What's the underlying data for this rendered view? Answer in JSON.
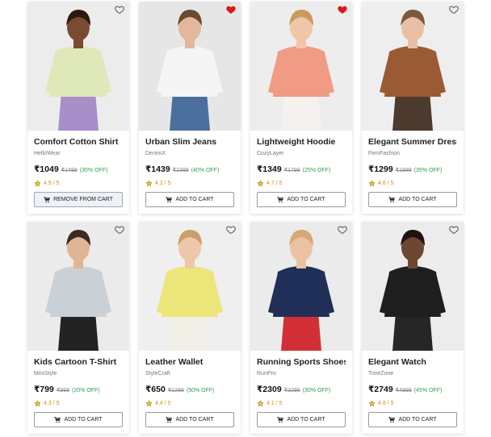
{
  "colors": {
    "heart_active": "#e0141e",
    "heart_inactive": "#555555",
    "rating": "#d28b14",
    "discount": "#2e9a4f"
  },
  "products": [
    {
      "title": "Comfort Cotton Shirt",
      "brand": "HelloWear",
      "price": "₹1049",
      "mrp": "₹1499",
      "discount": "(30% OFF)",
      "rating": "4.5 / 5",
      "button": "REMOVE FROM CART",
      "wishlisted": false,
      "in_cart": true,
      "photo_icon": "model-photo",
      "palette": {
        "skin": "#7a4b33",
        "hair": "#2a1a12",
        "top": "#dfe8b8",
        "bottom": "#a98fc9",
        "bg": "#ececec"
      }
    },
    {
      "title": "Urban Slim Jeans",
      "brand": "DenimX",
      "price": "₹1439",
      "mrp": "₹2399",
      "discount": "(40% OFF)",
      "rating": "4.2 / 5",
      "button": "ADD TO CART",
      "wishlisted": true,
      "in_cart": false,
      "photo_icon": "model-photo",
      "palette": {
        "skin": "#e2b79a",
        "hair": "#6b4a2d",
        "top": "#f5f5f5",
        "bottom": "#4a6f9c",
        "bg": "#e6e6e6"
      }
    },
    {
      "title": "Lightweight Hoodie",
      "brand": "CozyLayer",
      "price": "₹1349",
      "mrp": "₹1799",
      "discount": "(25% OFF)",
      "rating": "4.7 / 5",
      "button": "ADD TO CART",
      "wishlisted": true,
      "in_cart": false,
      "photo_icon": "model-photo",
      "palette": {
        "skin": "#efc6a8",
        "hair": "#c99a5b",
        "top": "#f19a84",
        "bottom": "#f4f2ee",
        "bg": "#ededed"
      }
    },
    {
      "title": "Elegant Summer Dress",
      "brand": "FemFashion",
      "price": "₹1299",
      "mrp": "₹1999",
      "discount": "(35% OFF)",
      "rating": "4.6 / 5",
      "button": "ADD TO CART",
      "wishlisted": false,
      "in_cart": false,
      "photo_icon": "model-photo",
      "palette": {
        "skin": "#e9c0a3",
        "hair": "#7a5a3b",
        "top": "#9a5a33",
        "bottom": "#4d3a2e",
        "bg": "#eeeeee"
      }
    },
    {
      "title": "Kids Cartoon T-Shirt",
      "brand": "MiniStyle",
      "price": "₹799",
      "mrp": "₹999",
      "discount": "(20% OFF)",
      "rating": "4.3 / 5",
      "button": "ADD TO CART",
      "wishlisted": false,
      "in_cart": false,
      "photo_icon": "model-photo",
      "palette": {
        "skin": "#e0b595",
        "hair": "#3a2a20",
        "top": "#c9d0d6",
        "bottom": "#232323",
        "bg": "#ebebeb"
      }
    },
    {
      "title": "Leather Wallet",
      "brand": "StyleCraft",
      "price": "₹650",
      "mrp": "₹1299",
      "discount": "(50% OFF)",
      "rating": "4.4 / 5",
      "button": "ADD TO CART",
      "wishlisted": false,
      "in_cart": false,
      "photo_icon": "model-photo",
      "palette": {
        "skin": "#eec7a9",
        "hair": "#c8a06a",
        "top": "#ece57a",
        "bottom": "#f2efe6",
        "bg": "#efefef"
      }
    },
    {
      "title": "Running Sports Shoes",
      "brand": "RunPro",
      "price": "₹2309",
      "mrp": "₹3299",
      "discount": "(30% OFF)",
      "rating": "4.1 / 5",
      "button": "ADD TO CART",
      "wishlisted": false,
      "in_cart": false,
      "photo_icon": "model-photo",
      "palette": {
        "skin": "#ecc2a2",
        "hair": "#d6a873",
        "top": "#1f2f57",
        "bottom": "#d32f36",
        "bg": "#ebebeb"
      }
    },
    {
      "title": "Elegant Watch",
      "brand": "TimeZone",
      "price": "₹2749",
      "mrp": "₹4999",
      "discount": "(45% OFF)",
      "rating": "4.8 / 5",
      "button": "ADD TO CART",
      "wishlisted": false,
      "in_cart": false,
      "photo_icon": "model-photo",
      "palette": {
        "skin": "#6e4632",
        "hair": "#1b1410",
        "top": "#1e1e1e",
        "bottom": "#262626",
        "bg": "#ececec"
      }
    }
  ]
}
